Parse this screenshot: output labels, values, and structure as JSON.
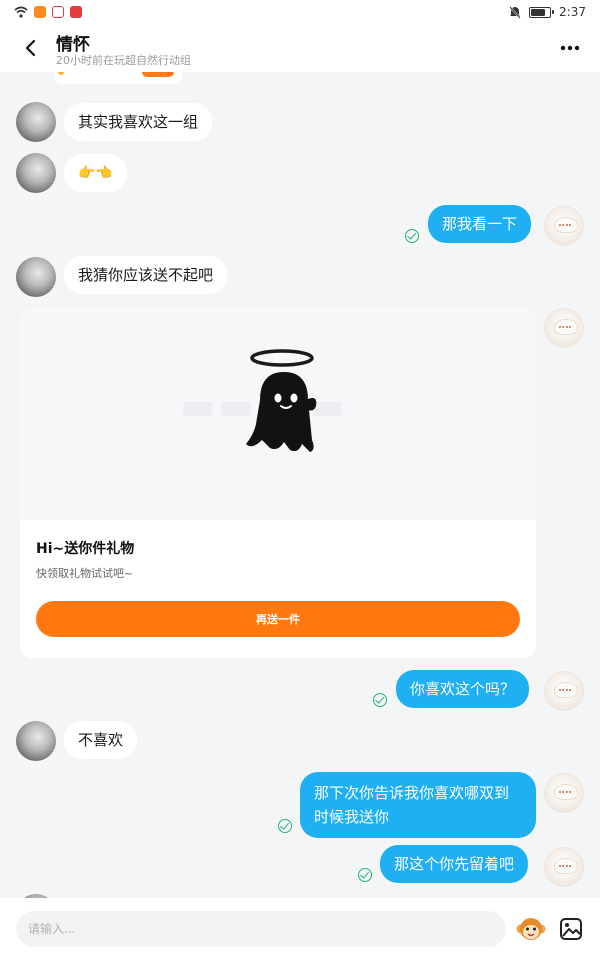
{
  "status_bar": {
    "time": "2:37",
    "app_icons": [
      "wifi-icon",
      "video-app-icon",
      "music-app-icon",
      "news-app-icon"
    ],
    "right_icons": [
      "mute-bell-icon",
      "battery-icon"
    ]
  },
  "header": {
    "title": "情怀",
    "subtitle": "20小时前在玩超自然行动组"
  },
  "messages": {
    "m1": "其实我喜欢这一组",
    "m2": "👉👈",
    "m3": "那我看一下",
    "m4": "我猜你应该送不起吧",
    "m5": "你喜欢这个吗？",
    "m6": "不喜欢",
    "m7": "那下次你告诉我你喜欢哪双到时候我送你",
    "m8": "那这个你先留着吧"
  },
  "gift_card": {
    "title": "Hi~送你件礼物",
    "description": "快领取礼物试试吧~",
    "button_label": "再送一件"
  },
  "input": {
    "placeholder": "请输入..."
  },
  "colors": {
    "my_bubble": "#1fb0f4",
    "other_bubble": "#ffffff",
    "accent_orange": "#ff7810",
    "read_check": "#22b573",
    "background": "#f4f5f7"
  }
}
